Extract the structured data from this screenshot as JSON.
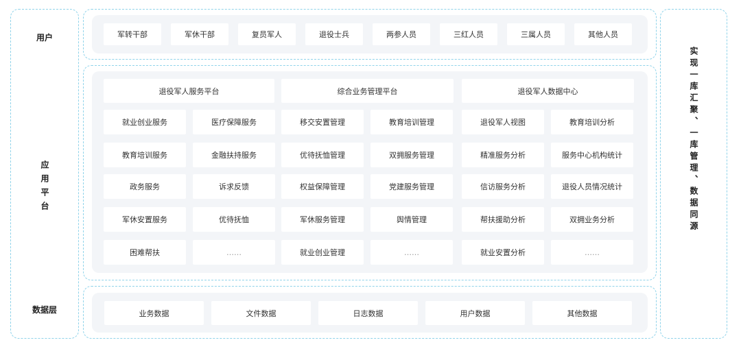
{
  "left_labels": {
    "users": "用户",
    "app_platform": "应用平台",
    "data_layer": "数据层"
  },
  "users_row": [
    "军转干部",
    "军休干部",
    "复员军人",
    "退役士兵",
    "两参人员",
    "三红人员",
    "三属人员",
    "其他人员"
  ],
  "platform_headers": [
    "退役军人服务平台",
    "综合业务管理平台",
    "退役军人数据中心"
  ],
  "platform_grid": [
    [
      "就业创业服务",
      "医疗保障服务",
      "移交安置管理",
      "教育培训管理",
      "退役军人视图",
      "教育培训分析"
    ],
    [
      "教育培训服务",
      "金融扶持服务",
      "优待抚恤管理",
      "双拥服务管理",
      "精准服务分析",
      "服务中心机构统计"
    ],
    [
      "政务服务",
      "诉求反馈",
      "权益保障管理",
      "党建服务管理",
      "信访服务分析",
      "退役人员情况统计"
    ],
    [
      "军休安置服务",
      "优待抚恤",
      "军休服务管理",
      "舆情管理",
      "帮扶援助分析",
      "双拥业务分析"
    ],
    [
      "困难帮扶",
      "……",
      "就业创业管理",
      "……",
      "就业安置分析",
      "……"
    ]
  ],
  "data_row": [
    "业务数据",
    "文件数据",
    "日志数据",
    "用户数据",
    "其他数据"
  ],
  "right_label": "实现一库汇聚、一库管理、数据同源"
}
